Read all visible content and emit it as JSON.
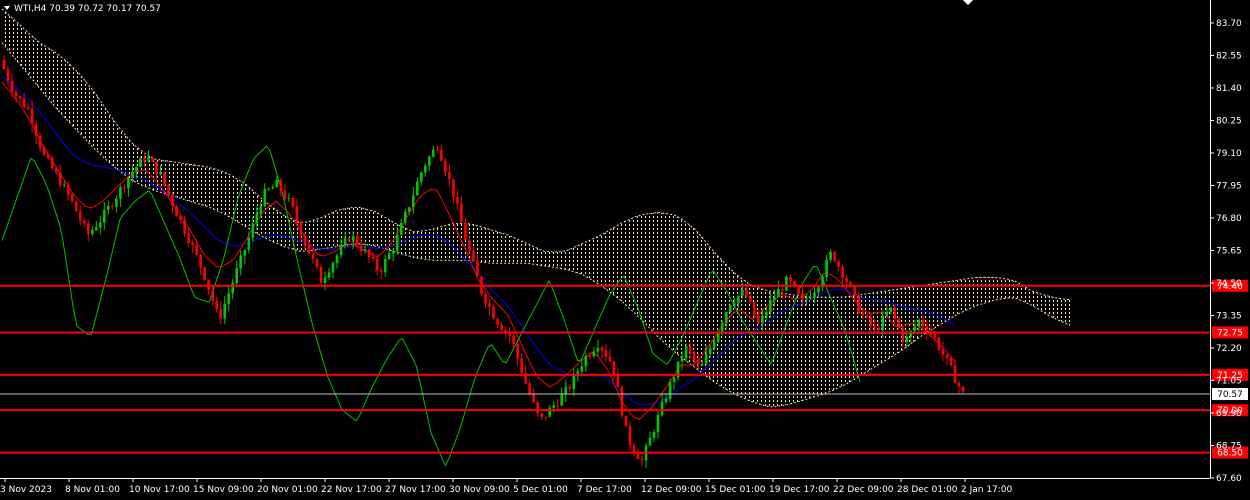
{
  "header": {
    "symbol_line": "WTI,H4  70.39 70.72 70.17 70.57"
  },
  "colors": {
    "background": "#000000",
    "axis": "#ffffff",
    "support_line": "#ff0000",
    "tenkan": "#ff0000",
    "kijun": "#0000ff",
    "chikou": "#00c000",
    "cloud": "#f5deb3",
    "bull": "#00c800",
    "bear": "#ff0000",
    "price_line": "#c0c0c0"
  },
  "chart_data": {
    "type": "candlestick",
    "ylim": [
      67.6,
      84.3
    ],
    "y_ticks": [
      "83.70",
      "82.55",
      "81.40",
      "80.25",
      "79.10",
      "77.95",
      "76.80",
      "75.65",
      "74.50",
      "73.35",
      "72.20",
      "71.05",
      "69.90",
      "68.75",
      "67.60"
    ],
    "x_ticks": [
      "3 Nov 2023",
      "8 Nov 01:00",
      "10 Nov 17:00",
      "15 Nov 09:00",
      "20 Nov 01:00",
      "22 Nov 17:00",
      "27 Nov 17:00",
      "30 Nov 09:00",
      "5 Dec 01:00",
      "7 Dec 17:00",
      "12 Dec 09:00",
      "15 Dec 01:00",
      "19 Dec 17:00",
      "22 Dec 09:00",
      "28 Dec 01:00",
      "2 Jan 17:00"
    ],
    "horizontal_levels": [
      {
        "label": "74.40",
        "value": 74.4
      },
      {
        "label": "72.75",
        "value": 72.75
      },
      {
        "label": "71.25",
        "value": 71.25
      },
      {
        "label": "70.00",
        "value": 70.0
      },
      {
        "label": "68.50",
        "value": 68.5
      }
    ],
    "current_price": {
      "label": "70.57",
      "value": 70.57
    },
    "price_path": [
      82.4,
      81.2,
      80.6,
      79.0,
      78.2,
      77.3,
      76.2,
      76.8,
      77.6,
      78.4,
      79.0,
      78.3,
      77.1,
      76.0,
      74.8,
      73.2,
      74.6,
      76.0,
      77.6,
      78.0,
      77.2,
      75.8,
      74.6,
      75.4,
      76.2,
      75.6,
      74.9,
      75.8,
      77.2,
      78.6,
      79.4,
      77.8,
      75.9,
      74.2,
      73.2,
      72.6,
      71.0,
      69.6,
      70.2,
      70.8,
      71.8,
      72.4,
      71.6,
      69.0,
      68.2,
      69.6,
      71.0,
      72.2,
      71.4,
      72.6,
      73.8,
      74.2,
      73.0,
      74.0,
      74.6,
      73.8,
      74.4,
      75.6,
      74.6,
      73.4,
      72.8,
      73.6,
      72.4,
      73.2,
      72.6,
      71.6,
      70.57
    ],
    "tenkan_path": [
      81.6,
      81.0,
      80.2,
      79.2,
      78.4,
      77.6,
      77.1,
      77.4,
      77.9,
      78.4,
      78.5,
      77.9,
      77.2,
      76.4,
      75.5,
      75.0,
      75.3,
      76.1,
      77.0,
      77.4,
      76.9,
      76.1,
      75.4,
      75.6,
      75.9,
      75.7,
      75.4,
      75.9,
      76.8,
      77.6,
      77.9,
      76.9,
      75.8,
      74.6,
      73.9,
      73.4,
      72.3,
      71.2,
      70.8,
      71.2,
      71.7,
      72.1,
      71.4,
      70.2,
      69.6,
      70.1,
      70.8,
      71.6,
      71.6,
      72.3,
      73.1,
      73.6,
      73.2,
      73.7,
      74.1,
      73.9,
      74.2,
      74.9,
      74.6,
      73.9,
      73.4,
      73.5,
      72.9,
      73.1,
      72.8,
      72.3,
      71.7
    ],
    "kijun_path": [
      81.8,
      81.4,
      80.9,
      80.3,
      79.6,
      79.0,
      78.7,
      78.6,
      78.5,
      78.3,
      78.1,
      77.8,
      77.4,
      77.0,
      76.5,
      76.0,
      75.8,
      75.9,
      76.1,
      76.2,
      76.1,
      75.9,
      75.7,
      75.7,
      75.8,
      75.8,
      75.7,
      75.8,
      76.0,
      76.2,
      76.2,
      75.9,
      75.4,
      74.8,
      74.2,
      73.7,
      73.0,
      72.2,
      71.6,
      71.3,
      71.2,
      71.3,
      71.1,
      70.6,
      70.2,
      70.2,
      70.4,
      70.8,
      71.1,
      71.6,
      72.1,
      72.6,
      72.8,
      73.1,
      73.5,
      73.7,
      73.9,
      74.2,
      74.3,
      74.1,
      73.9,
      73.9,
      73.7,
      73.6,
      73.5,
      73.3,
      73.0
    ],
    "chikou_path": [
      76.0,
      77.5,
      79.0,
      78.0,
      76.4,
      73.0,
      72.6,
      74.6,
      76.8,
      77.4,
      77.8,
      76.6,
      75.4,
      74.0,
      73.8,
      75.4,
      77.6,
      78.9,
      79.4,
      77.6,
      75.2,
      73.0,
      71.2,
      70.0,
      69.6,
      70.8,
      71.8,
      72.6,
      71.6,
      69.2,
      68.0,
      69.4,
      71.2,
      72.4,
      71.6,
      72.6,
      73.6,
      74.6,
      73.2,
      71.6,
      72.8,
      74.0,
      74.8,
      73.6,
      72.0,
      71.6,
      72.6,
      73.8,
      75.0,
      74.2,
      73.2,
      72.4,
      71.6,
      73.0,
      74.4,
      75.2,
      74.0,
      72.8,
      71.0
    ],
    "cloud_upper_path": [
      84.2,
      83.6,
      83.0,
      82.6,
      82.0,
      81.2,
      80.2,
      79.4,
      78.9,
      78.8,
      78.7,
      78.6,
      78.4,
      78.0,
      77.4,
      76.9,
      76.6,
      76.8,
      77.1,
      77.2,
      77.0,
      76.6,
      76.3,
      76.4,
      76.6,
      76.6,
      76.4,
      76.2,
      75.9,
      75.6,
      75.6,
      75.9,
      76.2,
      76.6,
      76.9,
      77.0,
      76.9,
      76.4,
      75.6,
      74.9,
      74.4,
      74.2,
      74.1,
      74.0,
      74.0,
      74.0,
      74.1,
      74.2,
      74.3,
      74.4,
      74.5,
      74.6,
      74.7,
      74.7,
      74.6,
      74.2,
      74.0,
      73.9
    ],
    "cloud_lower_path": [
      83.0,
      82.2,
      81.4,
      80.6,
      79.9,
      79.2,
      78.6,
      78.1,
      77.8,
      77.6,
      77.4,
      77.2,
      76.9,
      76.5,
      76.1,
      75.8,
      75.6,
      75.7,
      75.8,
      75.9,
      75.8,
      75.6,
      75.4,
      75.3,
      75.3,
      75.3,
      75.2,
      75.2,
      75.2,
      75.1,
      75.0,
      74.8,
      74.4,
      73.9,
      73.3,
      72.6,
      72.0,
      71.5,
      71.0,
      70.6,
      70.3,
      70.1,
      70.2,
      70.4,
      70.6,
      70.9,
      71.3,
      71.7,
      72.1,
      72.6,
      73.0,
      73.4,
      73.7,
      73.9,
      74.0,
      73.7,
      73.3,
      73.0
    ]
  }
}
